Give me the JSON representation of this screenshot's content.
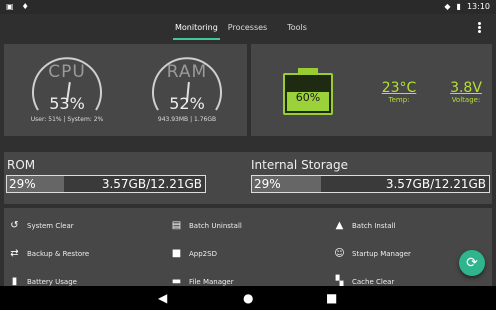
{
  "status": {
    "time": "13:10",
    "icons": [
      "screenshot-icon",
      "android-icon",
      "wifi-icon",
      "battery-status-icon"
    ]
  },
  "tabs": [
    {
      "label": "Monitoring",
      "active": true
    },
    {
      "label": "Processes",
      "active": false
    },
    {
      "label": "Tools",
      "active": false
    }
  ],
  "cpu": {
    "name": "CPU",
    "percent": "53%",
    "detail": "User: 51% | System: 2%",
    "value": 53
  },
  "ram": {
    "name": "RAM",
    "percent": "52%",
    "detail": "943.93MB | 1.76GB",
    "value": 52
  },
  "battery": {
    "level": "60%",
    "value": 60,
    "temp": "23°C",
    "temp_label": "Temp:",
    "voltage": "3.8V",
    "voltage_label": "Voltage:"
  },
  "rom": {
    "title": "ROM",
    "percent": "29%",
    "size": "3.57GB/12.21GB",
    "value": 29
  },
  "internal": {
    "title": "Internal Storage",
    "percent": "29%",
    "size": "3.57GB/12.21GB",
    "value": 29
  },
  "tools": [
    {
      "label": "System Clear",
      "icon": "history-clean-icon"
    },
    {
      "label": "Batch Uninstall",
      "icon": "batch-uninstall-icon"
    },
    {
      "label": "Batch Install",
      "icon": "android-install-icon"
    },
    {
      "label": "Backup & Restore",
      "icon": "backup-restore-icon"
    },
    {
      "label": "App2SD",
      "icon": "truck-icon"
    },
    {
      "label": "Startup Manager",
      "icon": "startup-smiley-icon"
    },
    {
      "label": "Battery Usage",
      "icon": "battery-usage-icon"
    },
    {
      "label": "File Manager",
      "icon": "folder-icon"
    },
    {
      "label": "Cache Clear",
      "icon": "cache-clear-icon"
    }
  ],
  "colors": {
    "accent": "#43c79c",
    "battery": "#9bd23a",
    "stat": "#b5e034",
    "fab": "#2fb58e"
  }
}
